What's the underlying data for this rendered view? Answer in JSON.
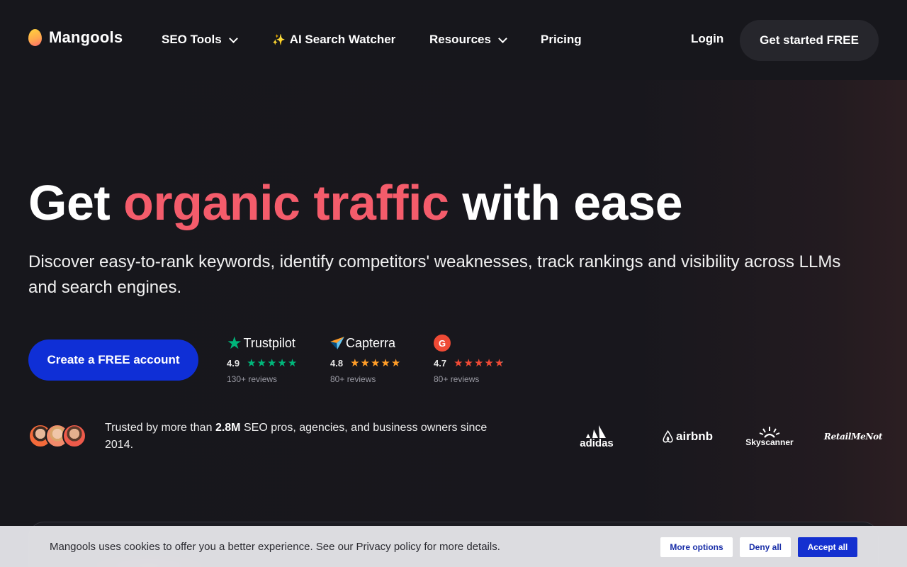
{
  "header": {
    "logo_text": "Mangools",
    "nav": [
      {
        "label": "SEO Tools",
        "has_dropdown": true
      },
      {
        "label": "AI Search Watcher",
        "has_dropdown": false,
        "icon": "sparkle-icon"
      },
      {
        "label": "Resources",
        "has_dropdown": true
      },
      {
        "label": "Pricing",
        "has_dropdown": false
      }
    ],
    "login_label": "Login",
    "cta_label": "Get started FREE"
  },
  "hero": {
    "title_pre": "Get",
    "title_accent": "organic traffic",
    "title_post": "with ease",
    "subtitle": "Discover easy-to-rank keywords, identify competitors' weaknesses, track rankings and visibility across LLMs and search engines.",
    "cta_label": "Create a FREE account"
  },
  "ratings": [
    {
      "brand": "Trustpilot",
      "score": "4.9",
      "reviews": "130+ reviews",
      "star_color": "#00b67a"
    },
    {
      "brand": "Capterra",
      "score": "4.8",
      "reviews": "80+ reviews",
      "star_color": "#ff9d28"
    },
    {
      "brand": "G2",
      "score": "4.7",
      "reviews": "80+ reviews",
      "star_color": "#ef4a35"
    }
  ],
  "trust": {
    "text_pre": "Trusted by more than",
    "highlight": "2.8M",
    "text_post": "SEO pros, agencies, and business owners since 2014."
  },
  "brands": [
    "adidas",
    "airbnb",
    "Skyscanner",
    "RetailMeNot"
  ],
  "cookie": {
    "message": "Mangools uses cookies to offer you a better experience. See our Privacy policy for more details.",
    "more_options": "More options",
    "deny_all": "Deny all",
    "accept_all": "Accept all"
  },
  "colors": {
    "accent": "#f45c6b",
    "primary_button": "#0f2fd6",
    "background": "#17171c"
  }
}
